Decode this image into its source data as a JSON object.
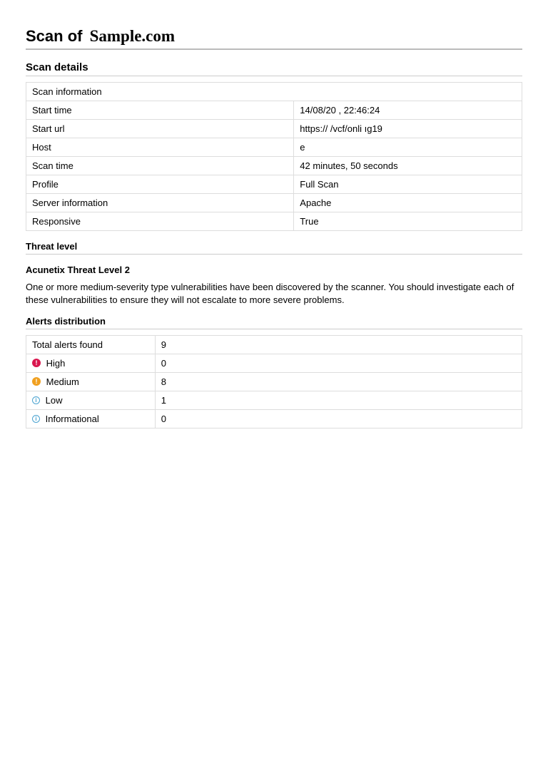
{
  "title_prefix": "Scan of",
  "title_target": "Sample.com",
  "scan_details_heading": "Scan details",
  "scan_info_header": "Scan information",
  "scan_info_rows": [
    {
      "label": "Start time",
      "value": "14/08/20    , 22:46:24"
    },
    {
      "label": "Start url",
      "value": "https://                         /vcf/onli                     ıg19"
    },
    {
      "label": "Host",
      "value": "e"
    },
    {
      "label": "Scan time",
      "value": "42 minutes, 50 seconds"
    },
    {
      "label": "Profile",
      "value": "Full Scan"
    },
    {
      "label": "Server information",
      "value": "Apache"
    },
    {
      "label": "Responsive",
      "value": "True"
    }
  ],
  "threat_level_heading": "Threat level",
  "threat_level_title": "Acunetix Threat Level 2",
  "threat_level_paragraph": "One or more medium-severity type vulnerabilities have been discovered by the scanner. You should investigate each of these vulnerabilities to ensure they will not escalate to more severe problems.",
  "alerts_heading": "Alerts distribution",
  "alerts_total_label": "Total alerts found",
  "alerts_total_value": "9",
  "alerts_rows": [
    {
      "severity": "high",
      "label": "High",
      "value": "0",
      "icon_glyph": "!"
    },
    {
      "severity": "medium",
      "label": "Medium",
      "value": "8",
      "icon_glyph": "!"
    },
    {
      "severity": "low",
      "label": "Low",
      "value": "1",
      "icon_glyph": "i"
    },
    {
      "severity": "info",
      "label": "Informational",
      "value": "0",
      "icon_glyph": "i"
    }
  ]
}
